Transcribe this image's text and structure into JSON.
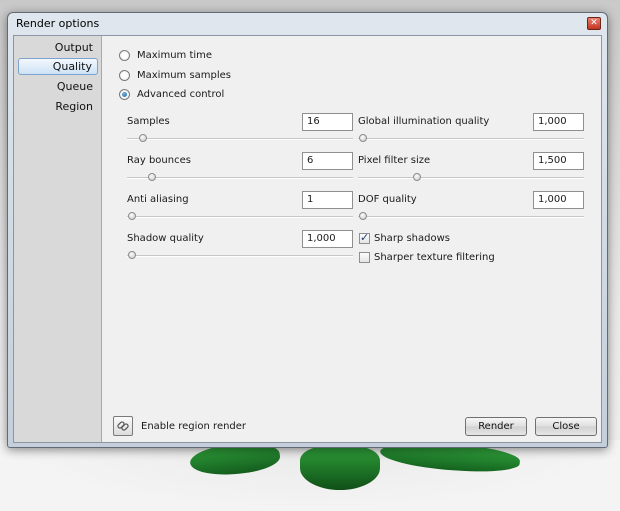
{
  "window": {
    "title": "Render options",
    "close_glyph": "✕"
  },
  "sidebar": {
    "items": [
      {
        "label": "Output"
      },
      {
        "label": "Quality"
      },
      {
        "label": "Queue"
      },
      {
        "label": "Region"
      }
    ],
    "selected": "Quality"
  },
  "mode": {
    "options": [
      {
        "label": "Maximum time"
      },
      {
        "label": "Maximum samples"
      },
      {
        "label": "Advanced control"
      }
    ],
    "selected": "Advanced control"
  },
  "params": {
    "samples": {
      "label": "Samples",
      "value": "16",
      "slider": 0.07
    },
    "ray_bounces": {
      "label": "Ray bounces",
      "value": "6",
      "slider": 0.11
    },
    "anti_aliasing": {
      "label": "Anti aliasing",
      "value": "1",
      "slider": 0.02
    },
    "shadow_quality": {
      "label": "Shadow quality",
      "value": "1,000",
      "slider": 0.02
    },
    "gi_quality": {
      "label": "Global illumination quality",
      "value": "1,000",
      "slider": 0.02
    },
    "pixel_filter": {
      "label": "Pixel filter size",
      "value": "1,500",
      "slider": 0.26
    },
    "dof_quality": {
      "label": "DOF quality",
      "value": "1,000",
      "slider": 0.02
    }
  },
  "checks": {
    "sharp_shadows": {
      "label": "Sharp shadows",
      "checked": true
    },
    "sharper_texture": {
      "label": "Sharper texture filtering",
      "checked": false
    }
  },
  "footer": {
    "region_render_label": "Enable region render",
    "render_label": "Render",
    "close_label": "Close",
    "region_icon": "region-link-icon"
  }
}
